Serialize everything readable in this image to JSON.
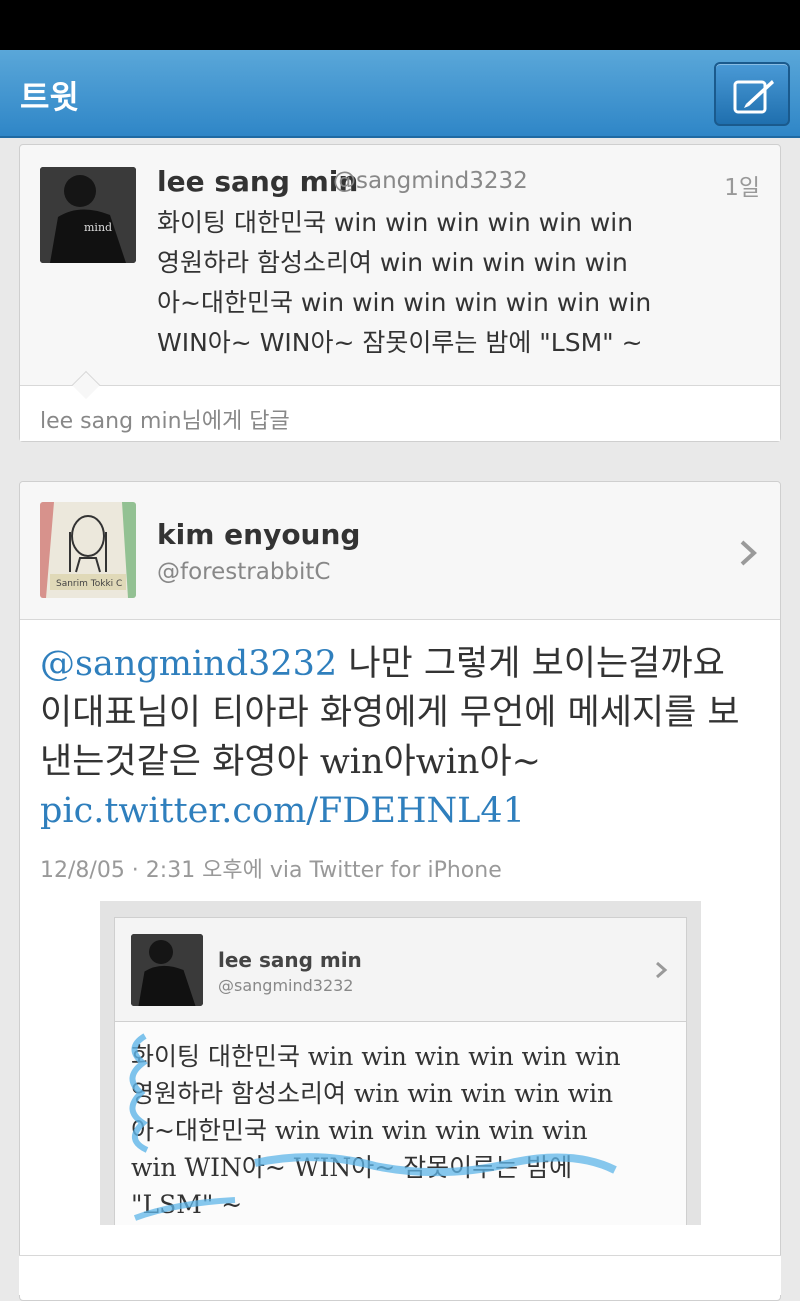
{
  "app_bar": {
    "title": "트윗",
    "compose_icon": "compose-icon"
  },
  "reply_tweet": {
    "name": "lee sang min",
    "handle": "@sangmind3232",
    "time": "1일",
    "text": "화이팅 대한민국 win win win win win win\n영원하라 함성소리여 win win win win win\n아~대한민국 win win win win win win win\nWIN아~ WIN아~ 잠못이루는 밤에 \"LSM\" ~",
    "reply_to": "lee sang min님에게 답글"
  },
  "main_tweet": {
    "name": "kim enyoung",
    "handle": "@forestrabbitC",
    "mention": "@sangmind3232",
    "body": " 나만 그렇게 보이는걸까요 이대표님이 티아라 화영에게 무언에 메세지를 보낸는것같은 화영아 win아win아~ ",
    "link": "pic.twitter.com/FDEHNL41",
    "meta": "12/8/05 · 2:31 오후에 via Twitter for iPhone"
  },
  "photo": {
    "name": "lee sang min",
    "handle": "@sangmind3232",
    "text": "화이팅 대한민국 win win win win win win\n영원하라 함성소리여 win win win win win\n아~대한민국 win win win win win win\nwin WIN아~ WIN아~ 잠못이루는 밤에\n\"LSM\" ~"
  },
  "colors": {
    "app_bar": "#3b93d0",
    "link": "#2f7fbd"
  }
}
